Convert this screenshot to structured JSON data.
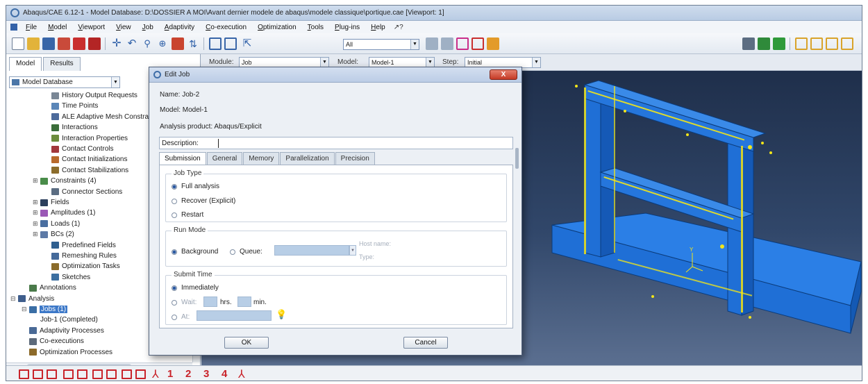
{
  "window": {
    "title": "Abaqus/CAE 6.12-1 - Model Database: D:\\DOSSIER A MOI\\Avant dernier modele de abaqus\\modele classique\\portique.cae [Viewport: 1]"
  },
  "menu": {
    "items": [
      "File",
      "Model",
      "Viewport",
      "View",
      "Job",
      "Adaptivity",
      "Co-execution",
      "Optimization",
      "Tools",
      "Plug-ins",
      "Help"
    ],
    "help_arrow": "↗?"
  },
  "toolbar": {
    "selection_filter": "All"
  },
  "context": {
    "module_label": "Module:",
    "module_value": "Job",
    "model_label": "Model:",
    "model_value": "Model-1",
    "step_label": "Step:",
    "step_value": "Initial"
  },
  "left_panel": {
    "tabs": [
      "Model",
      "Results"
    ],
    "database": "Model Database",
    "tree": [
      {
        "label": "History Output Requests",
        "depth": 3,
        "toggle": "",
        "icon": "#7a8796"
      },
      {
        "label": "Time Points",
        "depth": 3,
        "toggle": "",
        "icon": "#5a86b8"
      },
      {
        "label": "ALE Adaptive Mesh Constraints",
        "depth": 3,
        "toggle": "",
        "icon": "#4c6a9b"
      },
      {
        "label": "Interactions",
        "depth": 3,
        "toggle": "",
        "icon": "#3a6d3a"
      },
      {
        "label": "Interaction Properties",
        "depth": 3,
        "toggle": "",
        "icon": "#6b8c3c"
      },
      {
        "label": "Contact Controls",
        "depth": 3,
        "toggle": "",
        "icon": "#a2373b"
      },
      {
        "label": "Contact Initializations",
        "depth": 3,
        "toggle": "",
        "icon": "#b86a2c"
      },
      {
        "label": "Contact Stabilizations",
        "depth": 3,
        "toggle": "",
        "icon": "#8c6d2c"
      },
      {
        "label": "Constraints (4)",
        "depth": 2,
        "toggle": "⊞",
        "icon": "#4a8c4a"
      },
      {
        "label": "Connector Sections",
        "depth": 3,
        "toggle": "",
        "icon": "#5b6d82"
      },
      {
        "label": "Fields",
        "depth": 2,
        "toggle": "⊞",
        "icon": "#2c3f5c"
      },
      {
        "label": "Amplitudes (1)",
        "depth": 2,
        "toggle": "⊞",
        "icon": "#9b59b6"
      },
      {
        "label": "Loads (1)",
        "depth": 2,
        "toggle": "⊞",
        "icon": "#4a6fa0"
      },
      {
        "label": "BCs (2)",
        "depth": 2,
        "toggle": "⊞",
        "icon": "#5d7aa6"
      },
      {
        "label": "Predefined Fields",
        "depth": 3,
        "toggle": "",
        "icon": "#2f5f8f"
      },
      {
        "label": "Remeshing Rules",
        "depth": 3,
        "toggle": "",
        "icon": "#456a9a"
      },
      {
        "label": "Optimization Tasks",
        "depth": 3,
        "toggle": "",
        "icon": "#8a6b2a"
      },
      {
        "label": "Sketches",
        "depth": 3,
        "toggle": "",
        "icon": "#3c6fa0"
      },
      {
        "label": "Annotations",
        "depth": 1,
        "toggle": "",
        "icon": "#4a7a4a"
      },
      {
        "label": "Analysis",
        "depth": 0,
        "toggle": "⊟",
        "icon": "#3f5e8c"
      },
      {
        "label": "Jobs (1)",
        "depth": 1,
        "toggle": "⊟",
        "icon": "#3a6ea5",
        "selected": true
      },
      {
        "label": "Job-1 (Completed)",
        "depth": 2,
        "toggle": "",
        "icon": ""
      },
      {
        "label": "Adaptivity Processes",
        "depth": 1,
        "toggle": "",
        "icon": "#4a6a96"
      },
      {
        "label": "Co-executions",
        "depth": 1,
        "toggle": "",
        "icon": "#5d6a7a"
      },
      {
        "label": "Optimization Processes",
        "depth": 1,
        "toggle": "",
        "icon": "#8c6a2a"
      }
    ]
  },
  "dialog": {
    "title": "Edit Job",
    "close_label": "X",
    "name_line": "Name:  Job-2",
    "model_line": "Model:  Model-1",
    "product_line": "Analysis product:  Abaqus/Explicit",
    "description_label": "Description:",
    "description_value": "",
    "tabs": [
      "Submission",
      "General",
      "Memory",
      "Parallelization",
      "Precision"
    ],
    "job_type": {
      "label": "Job Type",
      "options": [
        "Full analysis",
        "Recover (Explicit)",
        "Restart"
      ],
      "selected": "Full analysis"
    },
    "run_mode": {
      "label": "Run Mode",
      "options": [
        "Background",
        "Queue:"
      ],
      "selected": "Background",
      "host_name_label": "Host name:",
      "type_label": "Type:"
    },
    "submit_time": {
      "label": "Submit Time",
      "options": [
        "Immediately",
        "Wait:",
        "At:"
      ],
      "selected": "Immediately",
      "hrs_label": "hrs.",
      "min_label": "min."
    },
    "ok_label": "OK",
    "cancel_label": "Cancel"
  },
  "bottom_toolbar": {
    "numbers": [
      "1",
      "2",
      "3",
      "4"
    ]
  },
  "colors": {
    "viewport_top": "#1f2f4b",
    "viewport_bottom": "#5b6f90",
    "model_blue": "#1f6fd6",
    "node_yellow": "#f2e51a",
    "selection": "#3c78c8"
  }
}
